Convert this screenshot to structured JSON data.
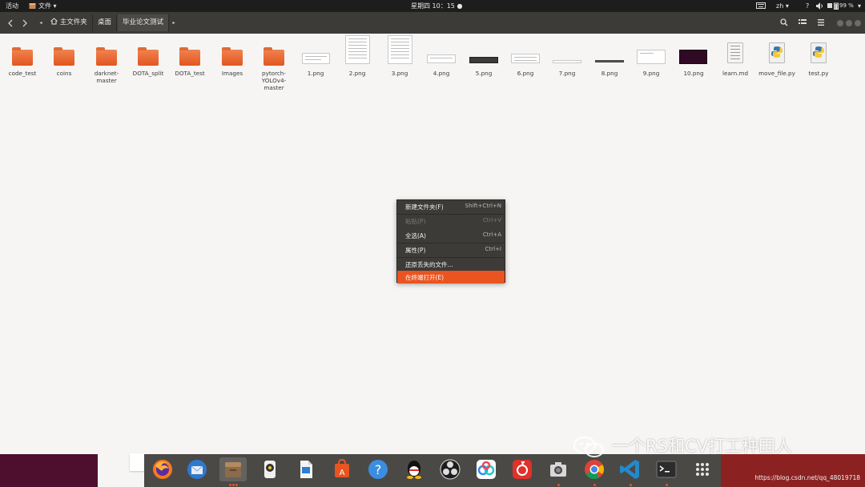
{
  "topbar": {
    "activities": "活动",
    "app_menu": "文件",
    "clock": "星期四 10：15",
    "lang": "zh",
    "battery": "99 %"
  },
  "header": {
    "breadcrumbs": [
      {
        "label": "主文件夹"
      },
      {
        "label": "桌面"
      },
      {
        "label": "毕业论文测试"
      }
    ]
  },
  "items": [
    {
      "label": "code_test",
      "kind": "folder"
    },
    {
      "label": "coins",
      "kind": "folder"
    },
    {
      "label": "darknet-master",
      "kind": "folder"
    },
    {
      "label": "DOTA_split",
      "kind": "folder"
    },
    {
      "label": "DOTA_test",
      "kind": "folder"
    },
    {
      "label": "Images",
      "kind": "folder"
    },
    {
      "label": "pytorch-YOLOv4-master",
      "kind": "folder"
    },
    {
      "label": "1.png",
      "kind": "image"
    },
    {
      "label": "2.png",
      "kind": "image"
    },
    {
      "label": "3.png",
      "kind": "image"
    },
    {
      "label": "4.png",
      "kind": "image"
    },
    {
      "label": "5.png",
      "kind": "image"
    },
    {
      "label": "6.png",
      "kind": "image"
    },
    {
      "label": "7.png",
      "kind": "image"
    },
    {
      "label": "8.png",
      "kind": "image"
    },
    {
      "label": "9.png",
      "kind": "image"
    },
    {
      "label": "10.png",
      "kind": "image"
    },
    {
      "label": "learn.md",
      "kind": "text"
    },
    {
      "label": "move_file.py",
      "kind": "python"
    },
    {
      "label": "test.py",
      "kind": "python"
    }
  ],
  "context_menu": {
    "items": [
      {
        "label": "新建文件夹(F)",
        "shortcut": "Shift+Ctrl+N",
        "enabled": true
      },
      {
        "label": "粘贴(P)",
        "shortcut": "Ctrl+V",
        "enabled": false
      },
      {
        "label": "全选(A)",
        "shortcut": "Ctrl+A",
        "enabled": true
      },
      {
        "label": "属性(P)",
        "shortcut": "Ctrl+I",
        "enabled": true
      },
      {
        "label": "还原丢失的文件...",
        "shortcut": "",
        "enabled": true
      },
      {
        "label": "在终端打开(E)",
        "shortcut": "",
        "enabled": true,
        "highlighted": true
      }
    ]
  },
  "dock": {
    "apps": [
      {
        "icon": "firefox-icon"
      },
      {
        "icon": "thunderbird-icon"
      },
      {
        "icon": "files-icon",
        "active": true
      },
      {
        "icon": "rhythmbox-icon"
      },
      {
        "icon": "libreoffice-writer-icon"
      },
      {
        "icon": "software-center-icon"
      },
      {
        "icon": "help-icon"
      },
      {
        "icon": "qq-icon"
      },
      {
        "icon": "obs-icon"
      },
      {
        "icon": "baidu-netdisk-icon"
      },
      {
        "icon": "netease-music-icon"
      },
      {
        "icon": "screenshot-icon"
      },
      {
        "icon": "chrome-icon"
      },
      {
        "icon": "vscode-icon"
      },
      {
        "icon": "terminal-icon"
      },
      {
        "icon": "app-grid-icon"
      }
    ]
  },
  "watermark": {
    "text": "一个RS和CV打工种田人",
    "url": "https://blog.csdn.net/qq_48019718"
  },
  "colors": {
    "accent": "#e95420",
    "header": "#3c3b37",
    "topbar": "#1d1d1d",
    "background": "#f6f5f4"
  }
}
